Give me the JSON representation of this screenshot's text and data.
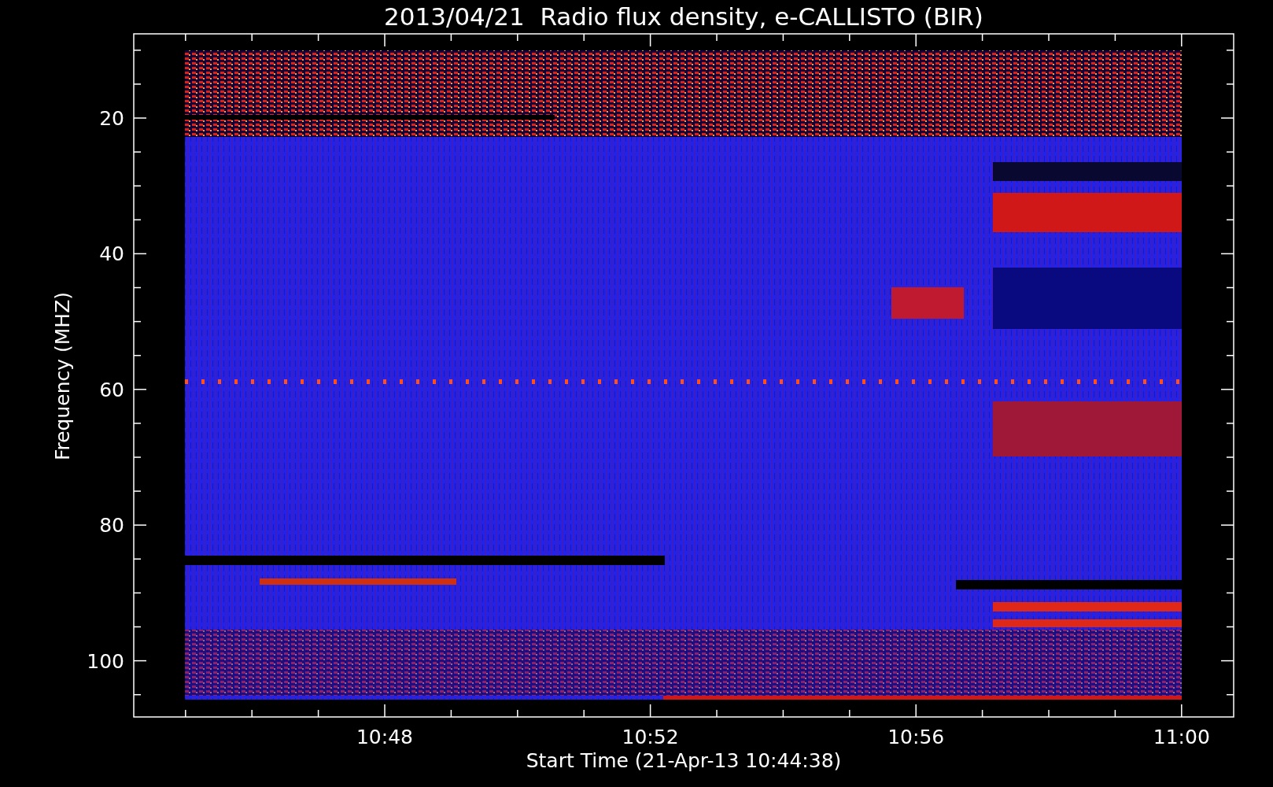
{
  "plot": {
    "title": "2013/04/21  Radio flux density, e-CALLISTO (BIR)",
    "ylabel": "Frequency (MHZ)",
    "xlabel": "Start Time (21-Apr-13 10:44:38)",
    "yticks": [
      "20",
      "40",
      "60",
      "80",
      "100"
    ],
    "xticks": [
      "10:48",
      "10:52",
      "10:56",
      "11:00"
    ]
  }
}
